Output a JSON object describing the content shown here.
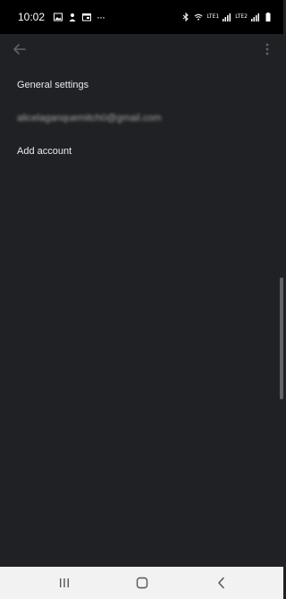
{
  "status_bar": {
    "time": "10:02",
    "overflow": "···",
    "sim1": "LTE1",
    "sim2": "LTE2"
  },
  "toolbar": {
    "back_icon": "arrow-left-icon",
    "more_icon": "more-vert-icon"
  },
  "menu": {
    "general_settings": "General settings",
    "account_email": "alicelaganquemitch0@gmail.com",
    "add_account": "Add account"
  },
  "nav_bar": {
    "recents_icon": "recents-icon",
    "home_icon": "home-icon",
    "back_icon": "back-chevron-icon"
  }
}
